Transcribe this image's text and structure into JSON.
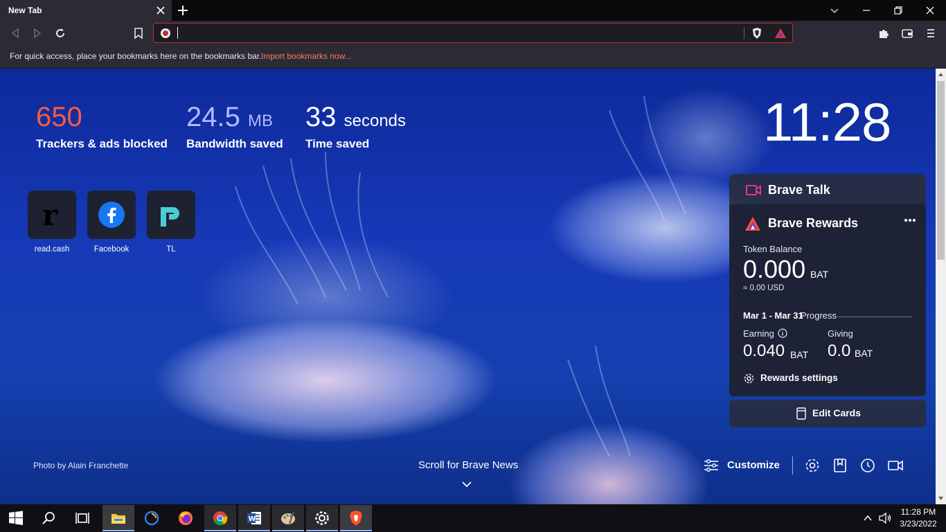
{
  "browser": {
    "tab_title": "New Tab",
    "bookmarks_hint": "For quick access, place your bookmarks here on the bookmarks bar.",
    "import_link": "Import bookmarks now...",
    "address_value": ""
  },
  "stats": {
    "trackers_value": "650",
    "trackers_label": "Trackers & ads blocked",
    "bandwidth_value": "24.5",
    "bandwidth_unit": "MB",
    "bandwidth_label": "Bandwidth saved",
    "time_value": "33",
    "time_unit": "seconds",
    "time_label": "Time saved",
    "trackers_color": "#ff5a3c",
    "bandwidth_color": "#b3b8ff"
  },
  "clock": "11:28",
  "top_sites": [
    {
      "label": "read.cash",
      "icon": "read-cash-icon"
    },
    {
      "label": "Facebook",
      "icon": "facebook-icon"
    },
    {
      "label": "TL",
      "icon": "tp-link-icon"
    }
  ],
  "brave_talk": {
    "title": "Brave Talk"
  },
  "rewards": {
    "title": "Brave Rewards",
    "token_balance_label": "Token Balance",
    "balance": "0.000",
    "balance_unit": "BAT",
    "usd": "≈ 0.00 USD",
    "period": "Mar 1 - Mar 31",
    "progress_label": "Progress",
    "earning_label": "Earning",
    "earning_value": "0.040",
    "earning_unit": "BAT",
    "giving_label": "Giving",
    "giving_value": "0.0",
    "giving_unit": "BAT",
    "settings_label": "Rewards settings"
  },
  "edit_cards_label": "Edit Cards",
  "photo_credit": "Photo by Alain Franchette",
  "scroll_news": "Scroll for Brave News",
  "customize_label": "Customize",
  "taskbar": {
    "time": "11:28 PM",
    "date": "3/23/2022"
  }
}
